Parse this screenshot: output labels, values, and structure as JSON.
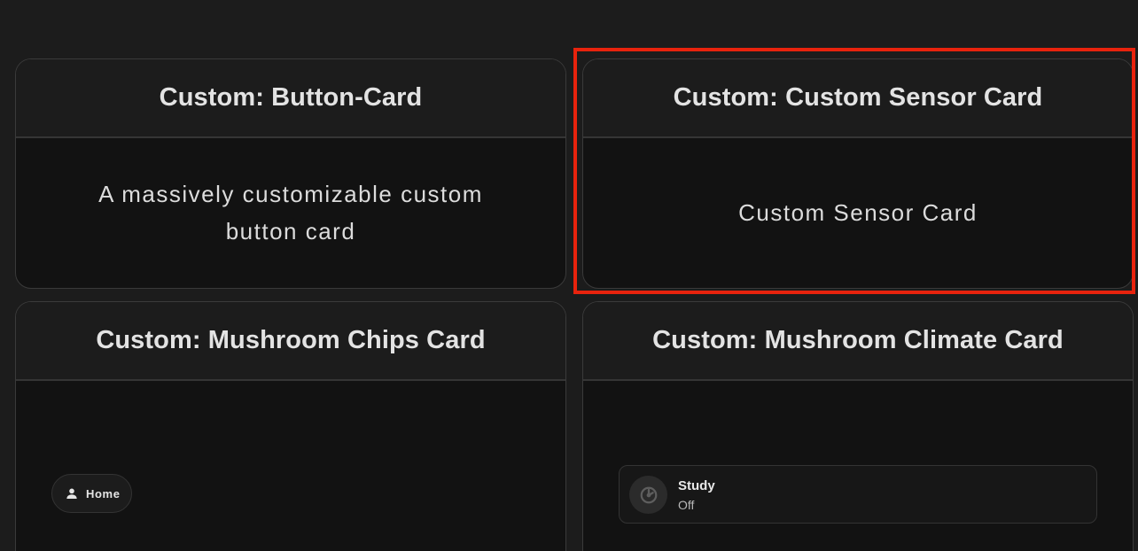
{
  "cards": [
    {
      "title": "Custom: Button-Card",
      "description_lines": [
        "A massively customizable custom",
        "button card"
      ]
    },
    {
      "title": "Custom: Custom Sensor Card",
      "description": "Custom Sensor Card"
    },
    {
      "title": "Custom: Mushroom Chips Card",
      "chip": {
        "label": "Home",
        "icon": "person-icon"
      }
    },
    {
      "title": "Custom: Mushroom Climate Card",
      "entity": {
        "name": "Study",
        "state": "Off",
        "icon": "thermostat-icon"
      }
    }
  ],
  "colors": {
    "page_background": "#1c1c1c",
    "card_background": "#121212",
    "highlight": "#e8230d"
  }
}
